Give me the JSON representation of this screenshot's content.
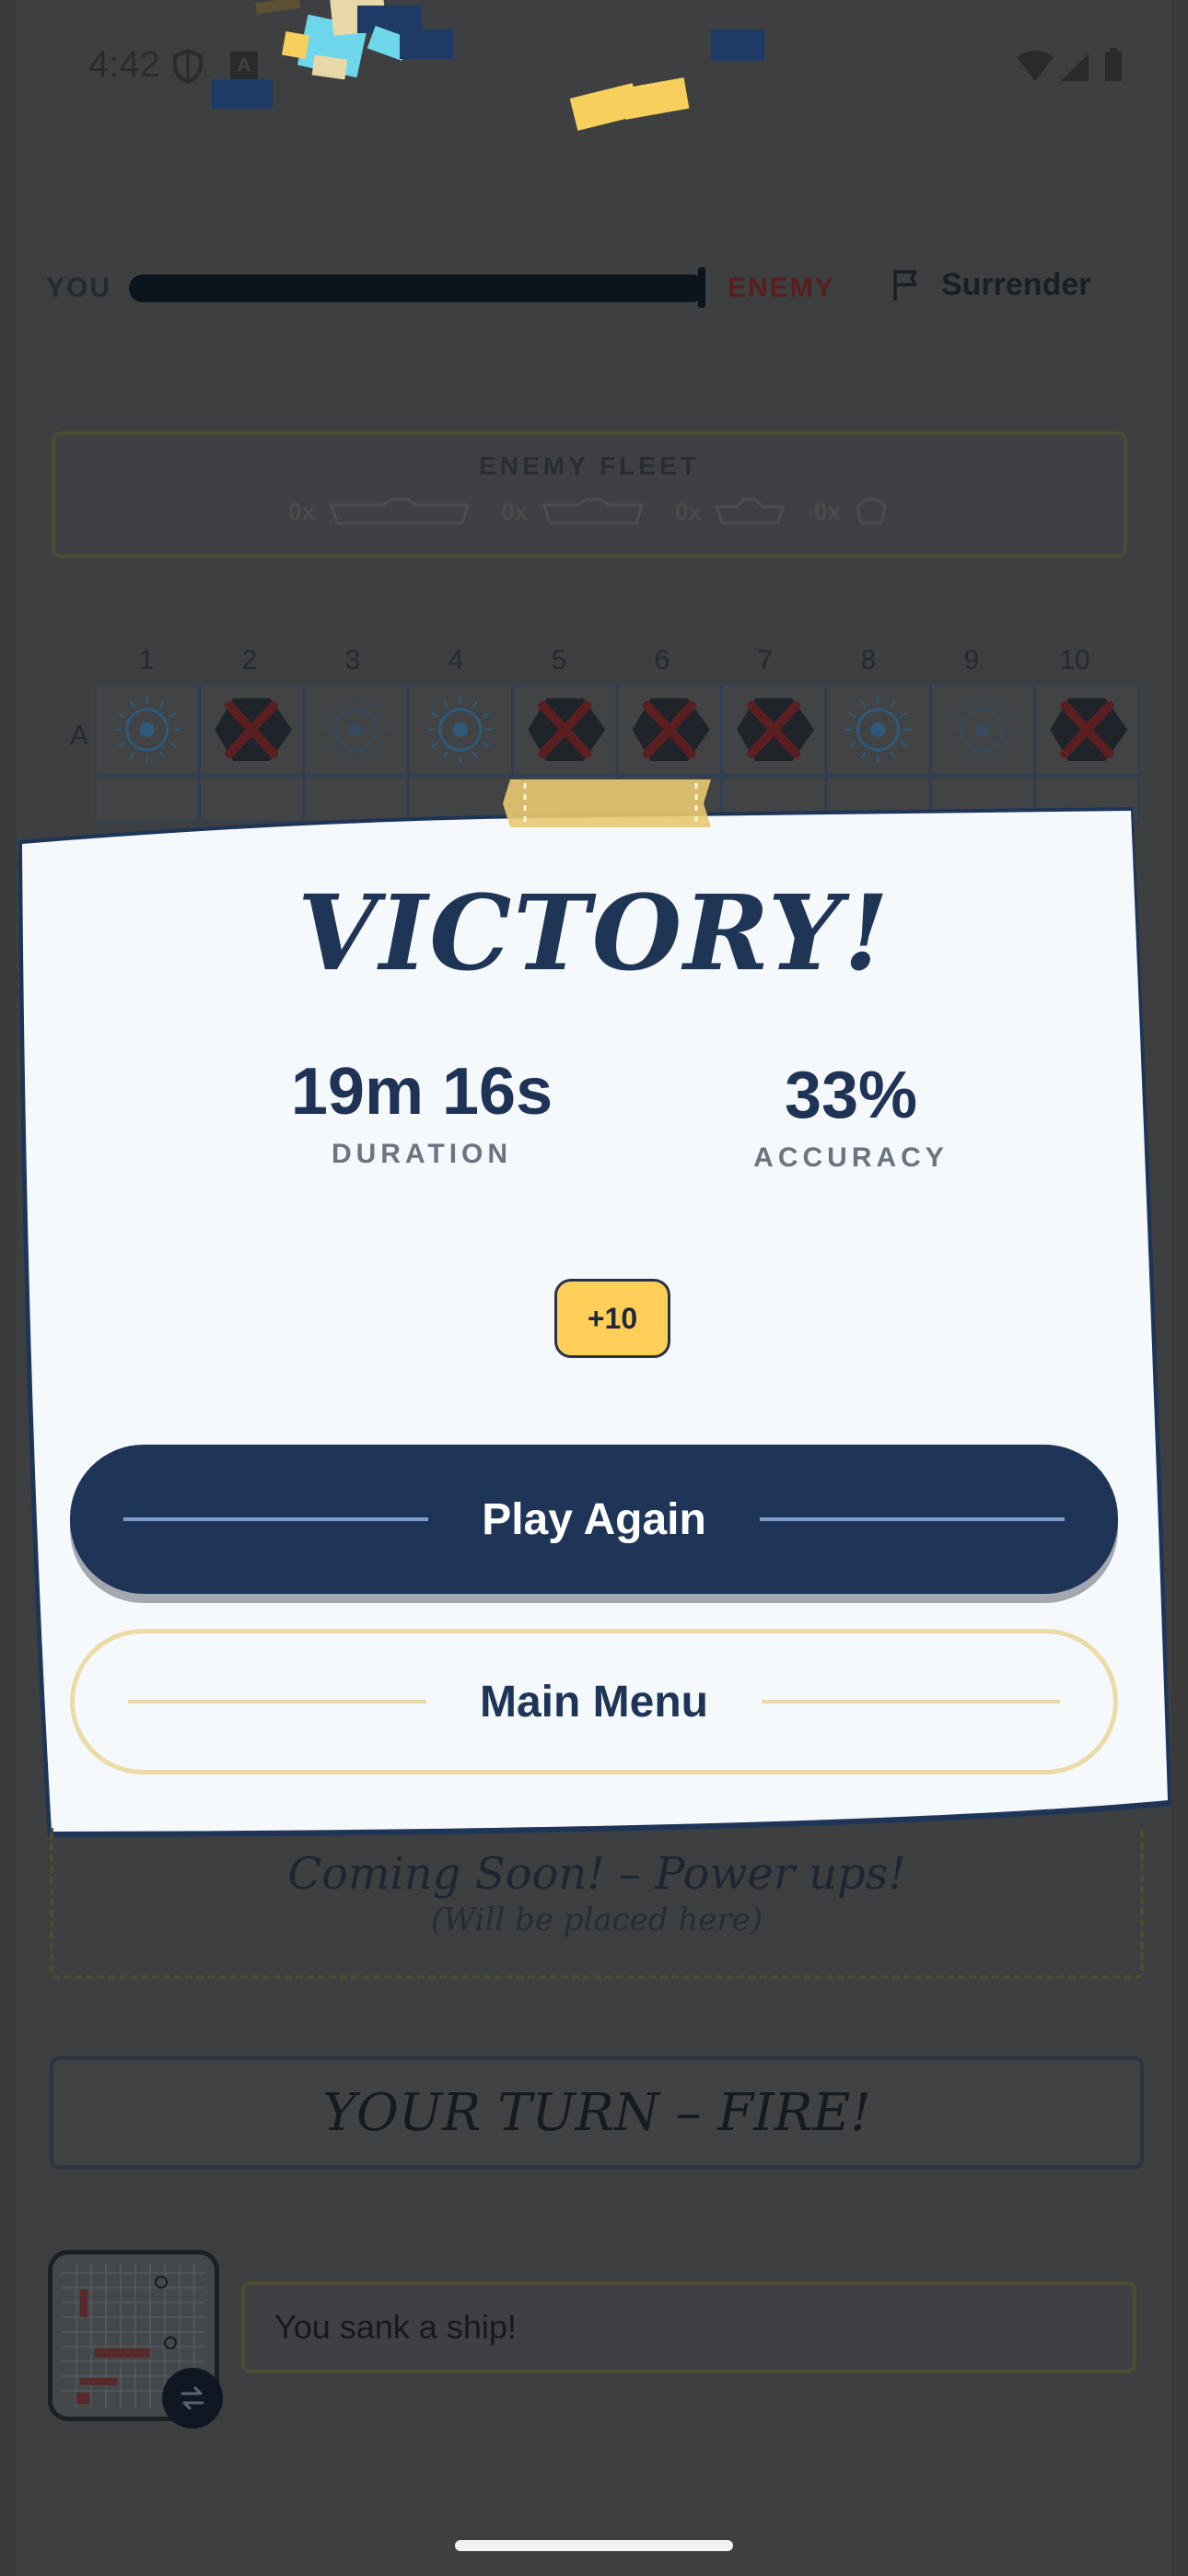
{
  "status_bar": {
    "time": "4:42"
  },
  "top_bar": {
    "you_label": "YOU",
    "enemy_label": "ENEMY",
    "surrender_label": "Surrender",
    "player_health_fraction": 1.0
  },
  "enemy_fleet": {
    "title": "ENEMY FLEET",
    "ships": [
      {
        "count": "0x",
        "icon": "ship-carrier-icon"
      },
      {
        "count": "0x",
        "icon": "ship-battleship-icon"
      },
      {
        "count": "0x",
        "icon": "ship-cruiser-icon"
      },
      {
        "count": "0x",
        "icon": "ship-patrol-icon"
      }
    ]
  },
  "grid": {
    "columns": [
      "1",
      "2",
      "3",
      "4",
      "5",
      "6",
      "7",
      "8",
      "9",
      "10"
    ],
    "row_label": "A",
    "row_a": [
      "miss",
      "sunk",
      "miss",
      "miss",
      "sunk",
      "sunk",
      "sunk",
      "miss",
      "miss",
      "sunk"
    ]
  },
  "result": {
    "title": "VICTORY!",
    "duration_value": "19m 16s",
    "duration_label": "DURATION",
    "accuracy_value": "33%",
    "accuracy_label": "ACCURACY",
    "reward": "+10",
    "play_again_label": "Play Again",
    "main_menu_label": "Main Menu"
  },
  "powerups": {
    "title": "Coming Soon! – Power ups!",
    "subtitle": "(Will be placed here)"
  },
  "turn_banner": "YOUR TURN – FIRE!",
  "message": "You sank a ship!",
  "colors": {
    "navy": "#1e3558",
    "cream": "#ecdba6",
    "reward": "#ffcf5a",
    "overlay": "#3d3f41"
  }
}
